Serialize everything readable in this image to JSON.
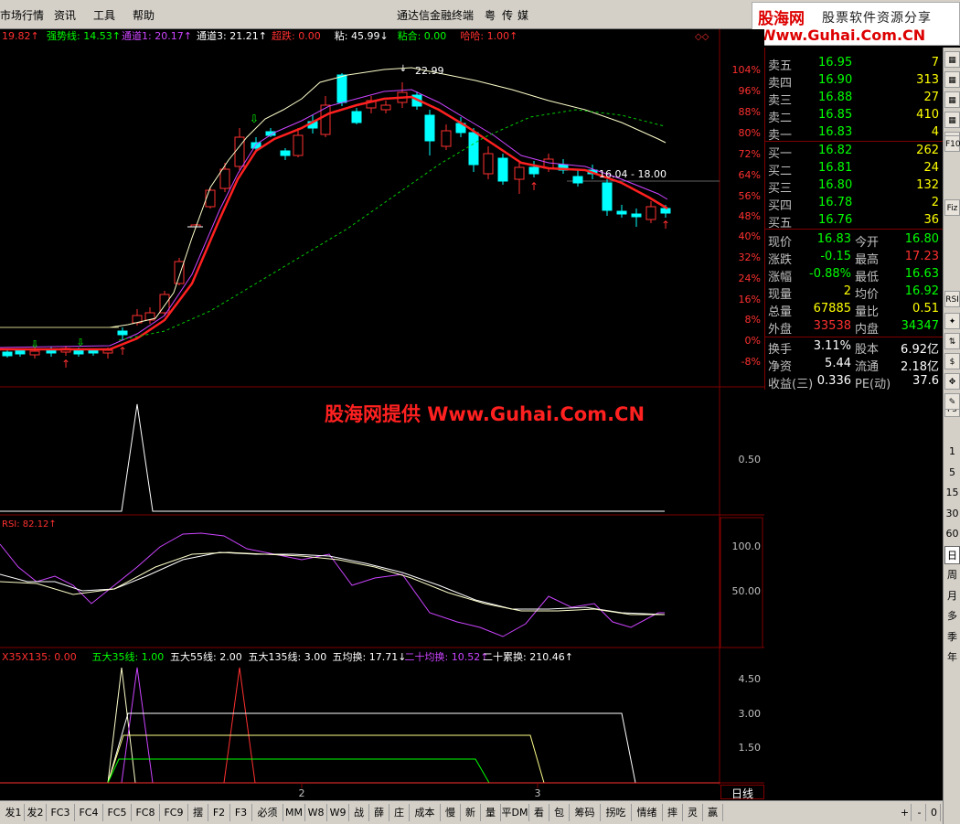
{
  "menu": {
    "items": [
      "市场行情",
      "资讯",
      "工具",
      "帮助"
    ],
    "app_title": "通达信金融终端",
    "extras": [
      "粤",
      "传",
      "媒"
    ]
  },
  "logo": {
    "brand": "股海网",
    "tagline": "股票软件资源分享",
    "url": "Www.Guhai.Com.CN"
  },
  "watermark": "股海网提供 Www.Guhai.Com.CN",
  "main_legend": [
    {
      "text": "19.82",
      "color": "#ff3030",
      "suffix": "↑"
    },
    {
      "text": "强势线: 14.53",
      "color": "#00ff00",
      "suffix": "↑"
    },
    {
      "text": "通道1: 20.17",
      "color": "#cc44ff",
      "suffix": "↑"
    },
    {
      "text": "通道3: 21.21",
      "color": "#ffffff",
      "suffix": "↑"
    },
    {
      "text": "超跌: 0.00",
      "color": "#ff3030",
      "suffix": ""
    },
    {
      "text": "粘: 45.99",
      "color": "#ffffff",
      "suffix": "↓"
    },
    {
      "text": "粘合: 0.00",
      "color": "#00ff00",
      "suffix": ""
    },
    {
      "text": "哈哈: 1.00",
      "color": "#ff3030",
      "suffix": "↑"
    }
  ],
  "price_axis": [
    "104%",
    "96%",
    "88%",
    "80%",
    "72%",
    "64%",
    "56%",
    "48%",
    "40%",
    "32%",
    "24%",
    "16%",
    "8%",
    "0%",
    "-8%"
  ],
  "annotations": {
    "high": "22.99",
    "range": "16.04 - 18.00"
  },
  "panel2_axis": [
    "0.50"
  ],
  "rsi": {
    "legend": "RSI: 82.12",
    "axis": [
      "100.0",
      "50.00"
    ]
  },
  "panel4": {
    "legend": [
      {
        "text": "X35X135: 0.00",
        "color": "#ff3030",
        "suffix": ""
      },
      {
        "text": "五大35线: 1.00",
        "color": "#00ff00",
        "suffix": ""
      },
      {
        "text": "五大55线: 2.00",
        "color": "#ffffff",
        "suffix": ""
      },
      {
        "text": "五大135线: 3.00",
        "color": "#ffffff",
        "suffix": ""
      },
      {
        "text": "五均换: 17.71",
        "color": "#ffffff",
        "suffix": "↓"
      },
      {
        "text": "二十均换: 10.52",
        "color": "#cc44ff",
        "suffix": "↑"
      },
      {
        "text": "二十累换: 210.46",
        "color": "#ffffff",
        "suffix": "↑"
      }
    ],
    "axis": [
      "4.50",
      "3.00",
      "1.50"
    ]
  },
  "x_labels": [
    "2",
    "3"
  ],
  "period": "日线",
  "quote": {
    "asks": [
      {
        "label": "卖五",
        "price": "16.95",
        "vol": "7"
      },
      {
        "label": "卖四",
        "price": "16.90",
        "vol": "313"
      },
      {
        "label": "卖三",
        "price": "16.88",
        "vol": "27"
      },
      {
        "label": "卖二",
        "price": "16.85",
        "vol": "410"
      },
      {
        "label": "卖一",
        "price": "16.83",
        "vol": "4"
      }
    ],
    "bids": [
      {
        "label": "买一",
        "price": "16.82",
        "vol": "262"
      },
      {
        "label": "买二",
        "price": "16.81",
        "vol": "24"
      },
      {
        "label": "买三",
        "price": "16.80",
        "vol": "132"
      },
      {
        "label": "买四",
        "price": "16.78",
        "vol": "2"
      },
      {
        "label": "买五",
        "price": "16.76",
        "vol": "36"
      }
    ],
    "stats": [
      {
        "l1": "现价",
        "v1": "16.83",
        "c1": "#00ff00",
        "l2": "今开",
        "v2": "16.80",
        "c2": "#00ff00"
      },
      {
        "l1": "涨跌",
        "v1": "-0.15",
        "c1": "#00ff00",
        "l2": "最高",
        "v2": "17.23",
        "c2": "#ff3030"
      },
      {
        "l1": "涨幅",
        "v1": "-0.88%",
        "c1": "#00ff00",
        "l2": "最低",
        "v2": "16.63",
        "c2": "#00ff00"
      },
      {
        "l1": "现量",
        "v1": "2",
        "c1": "#ffff00",
        "l2": "均价",
        "v2": "16.92",
        "c2": "#00ff00"
      },
      {
        "l1": "总量",
        "v1": "67885",
        "c1": "#ffff00",
        "l2": "量比",
        "v2": "0.51",
        "c2": "#ffff00"
      },
      {
        "l1": "外盘",
        "v1": "33538",
        "c1": "#ff3030",
        "l2": "内盘",
        "v2": "34347",
        "c2": "#00ff00"
      }
    ],
    "stats2": [
      {
        "l1": "换手",
        "v1": "3.11%",
        "l2": "股本",
        "v2": "6.92亿"
      },
      {
        "l1": "净资",
        "v1": "5.44",
        "l2": "流通",
        "v2": "2.18亿"
      },
      {
        "l1": "收益(三)",
        "v1": "0.336",
        "l2": "PE(动)",
        "v2": "37.6"
      }
    ]
  },
  "right_tools": [
    "F10",
    "Fiz",
    "RSI",
    "F5"
  ],
  "periods": [
    "1",
    "5",
    "15",
    "30",
    "60",
    "日",
    "周",
    "月",
    "多",
    "季",
    "年"
  ],
  "bottom_tabs": [
    "发1",
    "发2",
    "FC3",
    "FC4",
    "FC5",
    "FC8",
    "FC9",
    "摆",
    "F2",
    "F3",
    "必须",
    "MM",
    "W8",
    "W9",
    "战",
    "薛",
    "庄",
    "成本",
    "慢",
    "新",
    "量",
    "平DM",
    "看",
    "包",
    "筹码",
    "拐吃",
    "情绪",
    "摔",
    "灵",
    "赢",
    "+",
    "-",
    "0"
  ],
  "colors": {
    "up": "#ff3030",
    "down": "#00ffff",
    "ma_red": "#ff2020",
    "ma_purple": "#cc44ff",
    "ma_white": "#ffffcc",
    "dotted": "#00cc00"
  }
}
